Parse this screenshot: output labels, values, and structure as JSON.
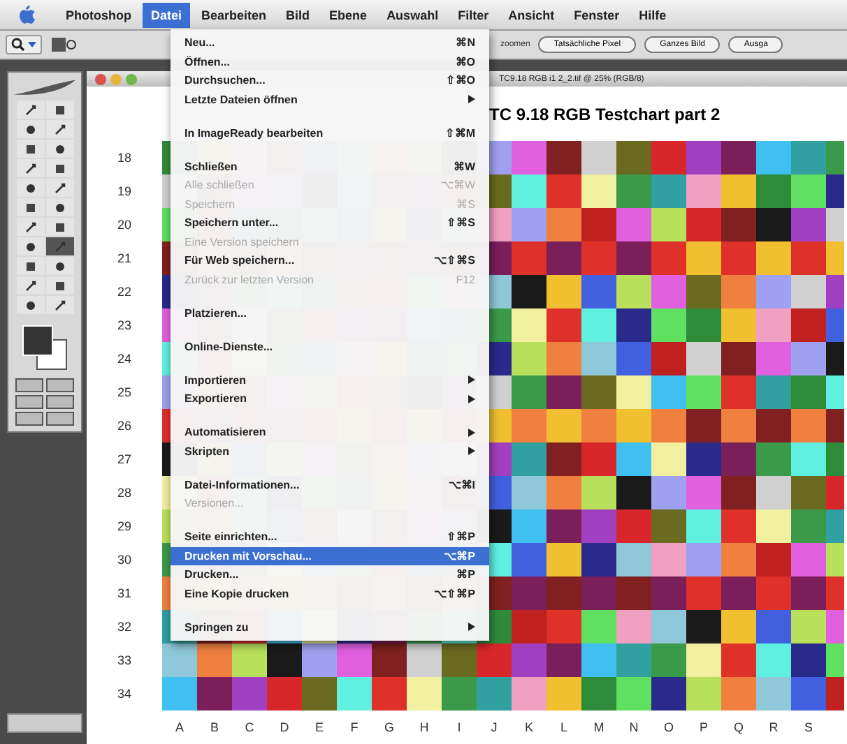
{
  "menubar": {
    "items": [
      {
        "label": "Photoshop",
        "selected": false,
        "app": true
      },
      {
        "label": "Datei",
        "selected": true
      },
      {
        "label": "Bearbeiten",
        "selected": false
      },
      {
        "label": "Bild",
        "selected": false
      },
      {
        "label": "Ebene",
        "selected": false
      },
      {
        "label": "Auswahl",
        "selected": false
      },
      {
        "label": "Filter",
        "selected": false
      },
      {
        "label": "Ansicht",
        "selected": false
      },
      {
        "label": "Fenster",
        "selected": false
      },
      {
        "label": "Hilfe",
        "selected": false
      }
    ]
  },
  "options_bar": {
    "partial_label": "zoomen",
    "buttons": [
      "Tatsächliche Pixel",
      "Ganzes Bild",
      "Ausga"
    ]
  },
  "menu": {
    "items": [
      {
        "kind": "item",
        "label": "Neu...",
        "shortcut": "⌘N",
        "disabled": false,
        "selected": false
      },
      {
        "kind": "item",
        "label": "Öffnen...",
        "shortcut": "⌘O",
        "disabled": false,
        "selected": false
      },
      {
        "kind": "item",
        "label": "Durchsuchen...",
        "shortcut": "⇧⌘O",
        "disabled": false,
        "selected": false
      },
      {
        "kind": "submenu",
        "label": "Letzte Dateien öffnen",
        "disabled": false,
        "selected": false
      },
      {
        "kind": "separator"
      },
      {
        "kind": "item",
        "label": "In ImageReady bearbeiten",
        "shortcut": "⇧⌘M",
        "disabled": false,
        "selected": false
      },
      {
        "kind": "separator"
      },
      {
        "kind": "item",
        "label": "Schließen",
        "shortcut": "⌘W",
        "disabled": false,
        "selected": false
      },
      {
        "kind": "item",
        "label": "Alle schließen",
        "shortcut": "⌥⌘W",
        "disabled": true,
        "selected": false
      },
      {
        "kind": "item",
        "label": "Speichern",
        "shortcut": "⌘S",
        "disabled": true,
        "selected": false
      },
      {
        "kind": "item",
        "label": "Speichern unter...",
        "shortcut": "⇧⌘S",
        "disabled": false,
        "selected": false
      },
      {
        "kind": "item",
        "label": "Eine Version speichern",
        "disabled": true,
        "selected": false
      },
      {
        "kind": "item",
        "label": "Für Web speichern...",
        "shortcut": "⌥⇧⌘S",
        "disabled": false,
        "selected": false
      },
      {
        "kind": "item",
        "label": "Zurück zur letzten Version",
        "shortcut": "F12",
        "disabled": true,
        "selected": false
      },
      {
        "kind": "separator"
      },
      {
        "kind": "item",
        "label": "Platzieren...",
        "disabled": false,
        "selected": false
      },
      {
        "kind": "separator"
      },
      {
        "kind": "item",
        "label": "Online-Dienste...",
        "disabled": false,
        "selected": false
      },
      {
        "kind": "separator"
      },
      {
        "kind": "submenu",
        "label": "Importieren",
        "disabled": false,
        "selected": false
      },
      {
        "kind": "submenu",
        "label": "Exportieren",
        "disabled": false,
        "selected": false
      },
      {
        "kind": "separator"
      },
      {
        "kind": "submenu",
        "label": "Automatisieren",
        "disabled": false,
        "selected": false
      },
      {
        "kind": "submenu",
        "label": "Skripten",
        "disabled": false,
        "selected": false
      },
      {
        "kind": "separator"
      },
      {
        "kind": "item",
        "label": "Datei-Informationen...",
        "shortcut": "⌥⌘I",
        "disabled": false,
        "selected": false
      },
      {
        "kind": "item",
        "label": "Versionen...",
        "disabled": true,
        "selected": false
      },
      {
        "kind": "separator"
      },
      {
        "kind": "item",
        "label": "Seite einrichten...",
        "shortcut": "⇧⌘P",
        "disabled": false,
        "selected": false
      },
      {
        "kind": "item",
        "label": "Drucken mit Vorschau...",
        "shortcut": "⌥⌘P",
        "disabled": false,
        "selected": true
      },
      {
        "kind": "item",
        "label": "Drucken...",
        "shortcut": "⌘P",
        "disabled": false,
        "selected": false
      },
      {
        "kind": "item",
        "label": "Eine Kopie drucken",
        "shortcut": "⌥⇧⌘P",
        "disabled": false,
        "selected": false
      },
      {
        "kind": "separator"
      },
      {
        "kind": "submenu",
        "label": "Springen zu",
        "disabled": false,
        "selected": false
      }
    ]
  },
  "document": {
    "title": "TC9.18 RGB i1 2_2.tif @ 25% (RGB/8)",
    "heading": "TC 9.18 RGB Testchart part 2",
    "row_labels": [
      "18",
      "19",
      "20",
      "21",
      "22",
      "23",
      "24",
      "25",
      "26",
      "27",
      "28",
      "29",
      "30",
      "31",
      "32",
      "33",
      "34"
    ],
    "column_labels": [
      "A",
      "B",
      "C",
      "D",
      "E",
      "F",
      "G",
      "H",
      "I",
      "J",
      "K",
      "L",
      "M",
      "N",
      "O",
      "P",
      "Q",
      "R",
      "S"
    ]
  }
}
